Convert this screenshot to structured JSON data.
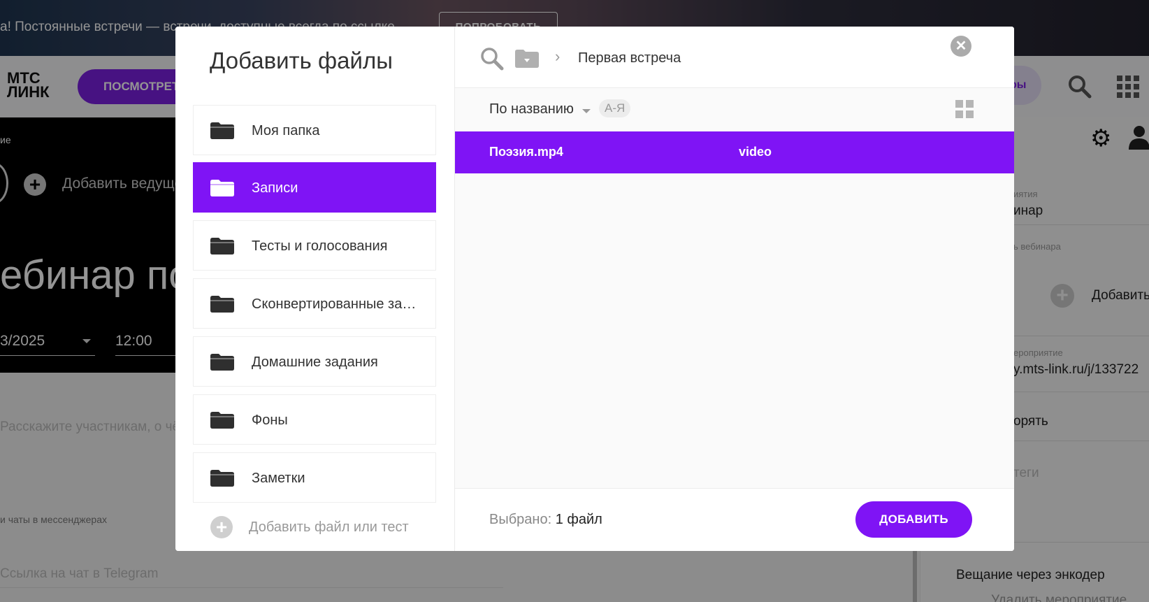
{
  "promo": {
    "text": "а! Постоянные встречи — встречи, доступные всегда по ссылке",
    "button": "ПОПРОБОВАТЬ"
  },
  "header": {
    "logo_line1": "МТС",
    "logo_line2": "ЛИНК",
    "watch_button": "ПОСМОТРЕТЬ",
    "pill": "ры"
  },
  "background": {
    "hero_small": "ие",
    "add_host": "Добавить ведущего",
    "title": "ебинар по",
    "date": "3/2025",
    "time": "12:00",
    "describe_placeholder": "Расскажите участникам, о чём",
    "chats_label": "и чаты в мессенджерах",
    "telegram_placeholder": "Ссылка на чат в Telegram",
    "right": {
      "label_type": "иятия",
      "value_type": "инар",
      "label_record": "ь вебинара",
      "add": "Добавить",
      "label_link": "ероприятие",
      "link": "y.mts-link.ru/j/133722",
      "repeat": "орять",
      "tags": "теги",
      "encoder": "Вещание через энкодер",
      "delete": "Удалить мероприятие"
    }
  },
  "modal": {
    "title": "Добавить файлы",
    "folders": [
      {
        "label": "Моя папка",
        "active": false
      },
      {
        "label": "Записи",
        "active": true
      },
      {
        "label": "Тесты и голосования",
        "active": false
      },
      {
        "label": "Сконвертированные записи",
        "active": false
      },
      {
        "label": "Домашние задания",
        "active": false
      },
      {
        "label": "Фоны",
        "active": false
      },
      {
        "label": "Заметки",
        "active": false
      }
    ],
    "add_file": "Добавить файл или тест",
    "breadcrumb": {
      "separator": "›",
      "current": "Первая встреча"
    },
    "sort": {
      "label": "По названию",
      "order": "А-Я"
    },
    "files": [
      {
        "name": "Поэзия.mp4",
        "type": "video",
        "selected": true
      }
    ],
    "footer": {
      "selected_label": "Выбрано:",
      "selected_count": "1 файл",
      "add_button": "ДОБАВИТЬ"
    },
    "colors": {
      "accent": "#7f14f5"
    }
  }
}
